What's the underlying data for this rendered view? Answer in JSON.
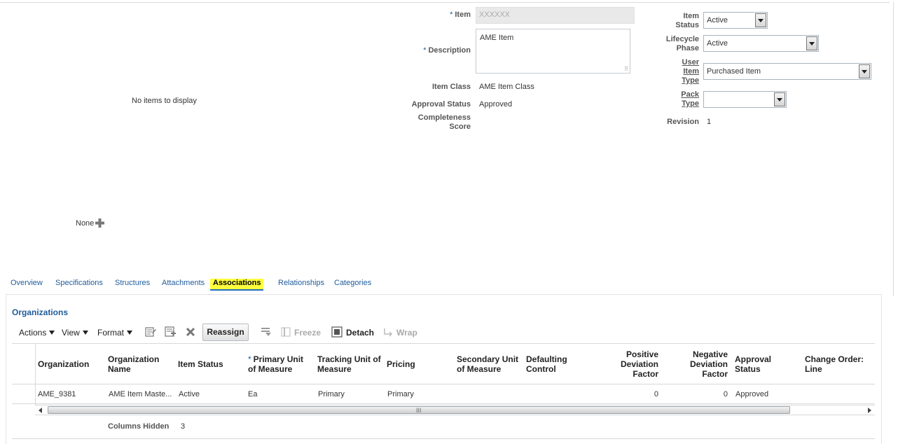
{
  "header": {
    "item_label": "Item",
    "item_value": "XXXXXX",
    "description_label": "Description",
    "description_value": "AME Item",
    "item_class_label": "Item Class",
    "item_class_value": "AME Item Class",
    "approval_status_label": "Approval Status",
    "approval_status_value": "Approved",
    "completeness_label_1": "Completeness",
    "completeness_label_2": "Score",
    "item_status_label_1": "Item",
    "item_status_label_2": "Status",
    "item_status_value": "Active",
    "lifecycle_label_1": "Lifecycle",
    "lifecycle_label_2": "Phase",
    "lifecycle_value": "Active",
    "user_item_type_label_1": "User",
    "user_item_type_label_2": "Item",
    "user_item_type_label_3": "Type",
    "user_item_type_value": "Purchased Item",
    "pack_type_label_1": "Pack",
    "pack_type_label_2": "Type",
    "pack_type_value": "",
    "revision_label": "Revision",
    "revision_value": "1",
    "required_marker": "*"
  },
  "left": {
    "empty_text": "No items to display",
    "none_label": "None"
  },
  "tabs": [
    {
      "label": "Overview"
    },
    {
      "label": "Specifications"
    },
    {
      "label": "Structures"
    },
    {
      "label": "Attachments"
    },
    {
      "label": "Associations"
    },
    {
      "label": "Relationships"
    },
    {
      "label": "Categories"
    }
  ],
  "organizations": {
    "title": "Organizations",
    "toolbar": {
      "actions": "Actions",
      "view": "View",
      "format": "Format",
      "reassign": "Reassign",
      "freeze": "Freeze",
      "detach": "Detach",
      "wrap": "Wrap"
    },
    "columns": [
      {
        "l1": "Organization",
        "l2": ""
      },
      {
        "l1": "Organization",
        "l2": "Name"
      },
      {
        "l1": "Item Status",
        "l2": ""
      },
      {
        "l1": "Primary Unit",
        "l2": "of Measure"
      },
      {
        "l1": "Tracking Unit of",
        "l2": "Measure"
      },
      {
        "l1": "Pricing",
        "l2": ""
      },
      {
        "l1": "Secondary Unit",
        "l2": "of Measure"
      },
      {
        "l1": "Defaulting",
        "l2": "Control"
      },
      {
        "l1": "Positive",
        "l2": "Deviation",
        "l3": "Factor"
      },
      {
        "l1": "Negative",
        "l2": "Deviation",
        "l3": "Factor"
      },
      {
        "l1": "Approval",
        "l2": "Status"
      },
      {
        "l1": "Change Order:",
        "l2": "Line"
      }
    ],
    "rows": [
      {
        "organization": "AME_9381",
        "organization_name": "AME Item Maste...",
        "item_status": "Active",
        "primary_uom": "Ea",
        "tracking_uom": "Primary",
        "pricing": "Primary",
        "secondary_uom": "",
        "defaulting_control": "",
        "positive_deviation": "0",
        "negative_deviation": "0",
        "approval_status": "Approved",
        "change_order_line": ""
      }
    ],
    "columns_hidden_label": "Columns Hidden",
    "columns_hidden_value": "3",
    "scroll_grip": "III"
  }
}
